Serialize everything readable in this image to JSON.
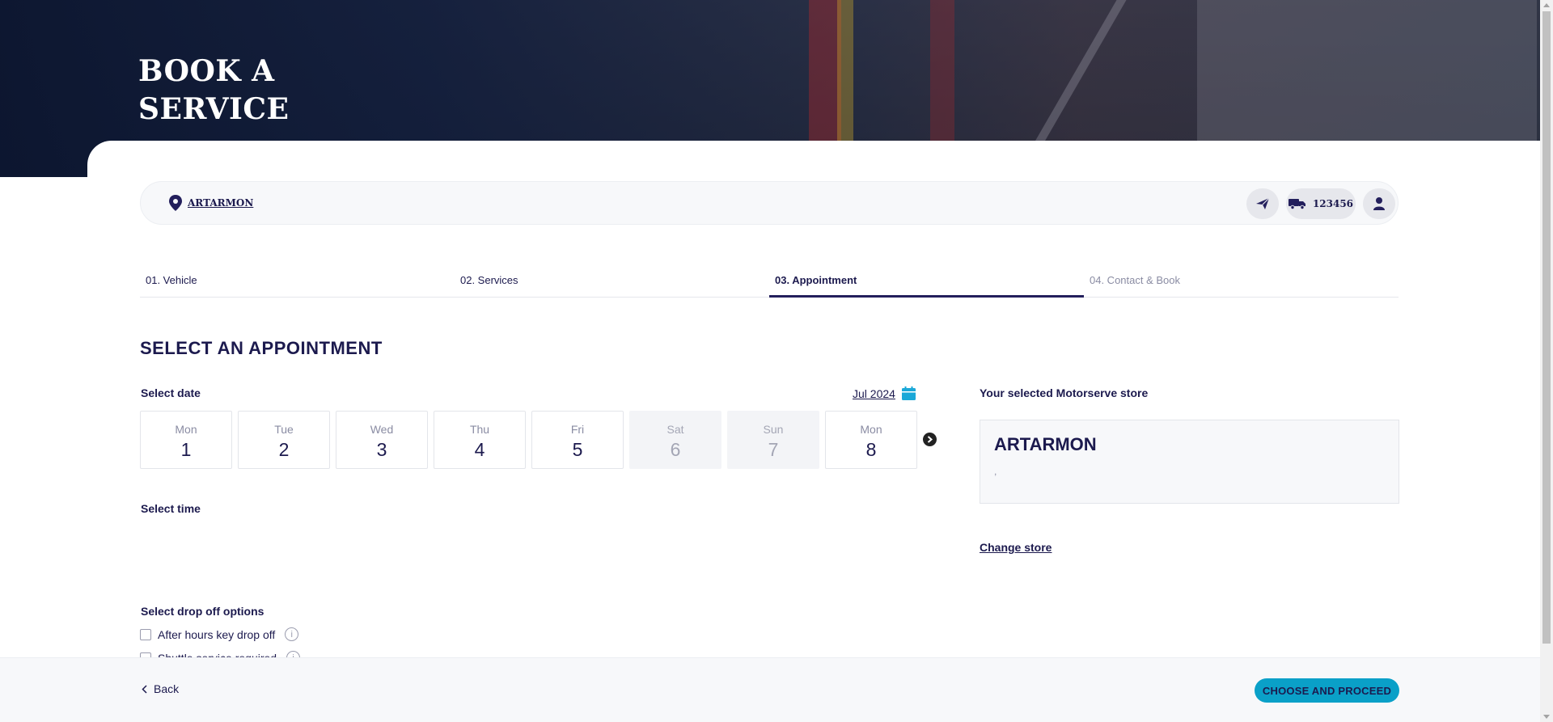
{
  "hero": {
    "title": "BOOK A SERVICE"
  },
  "location_bar": {
    "store": "ARTARMON",
    "vehicle_rego": "123456",
    "icons": [
      "location-pin-icon",
      "send-icon",
      "truck-icon",
      "user-icon"
    ]
  },
  "steps": [
    {
      "label": "01. Vehicle",
      "state": "done"
    },
    {
      "label": "02. Services",
      "state": "done"
    },
    {
      "label": "03. Appointment",
      "state": "active"
    },
    {
      "label": "04. Contact & Book",
      "state": "disabled"
    }
  ],
  "appointment": {
    "title": "SELECT AN APPOINTMENT",
    "select_date_label": "Select date",
    "month": "Jul 2024",
    "days": [
      {
        "name": "Mon",
        "date": "1",
        "available": true
      },
      {
        "name": "Tue",
        "date": "2",
        "available": true
      },
      {
        "name": "Wed",
        "date": "3",
        "available": true
      },
      {
        "name": "Thu",
        "date": "4",
        "available": true
      },
      {
        "name": "Fri",
        "date": "5",
        "available": true
      },
      {
        "name": "Sat",
        "date": "6",
        "available": false
      },
      {
        "name": "Sun",
        "date": "7",
        "available": false
      },
      {
        "name": "Mon",
        "date": "8",
        "available": true
      }
    ],
    "select_time_label": "Select time",
    "drop_off_label": "Select drop off options",
    "drop_off_options": [
      "After hours key drop off",
      "Shuttle service required"
    ]
  },
  "store_panel": {
    "label": "Your selected Motorserve store",
    "store_name": "ARTARMON",
    "address": ",",
    "change_store": "Change store"
  },
  "footer": {
    "back": "Back",
    "proceed": "CHOOSE AND PROCEED"
  },
  "colors": {
    "navy": "#1c1a4e",
    "accent": "#0aa0c8",
    "calendar_icon": "#1aa8d8"
  }
}
